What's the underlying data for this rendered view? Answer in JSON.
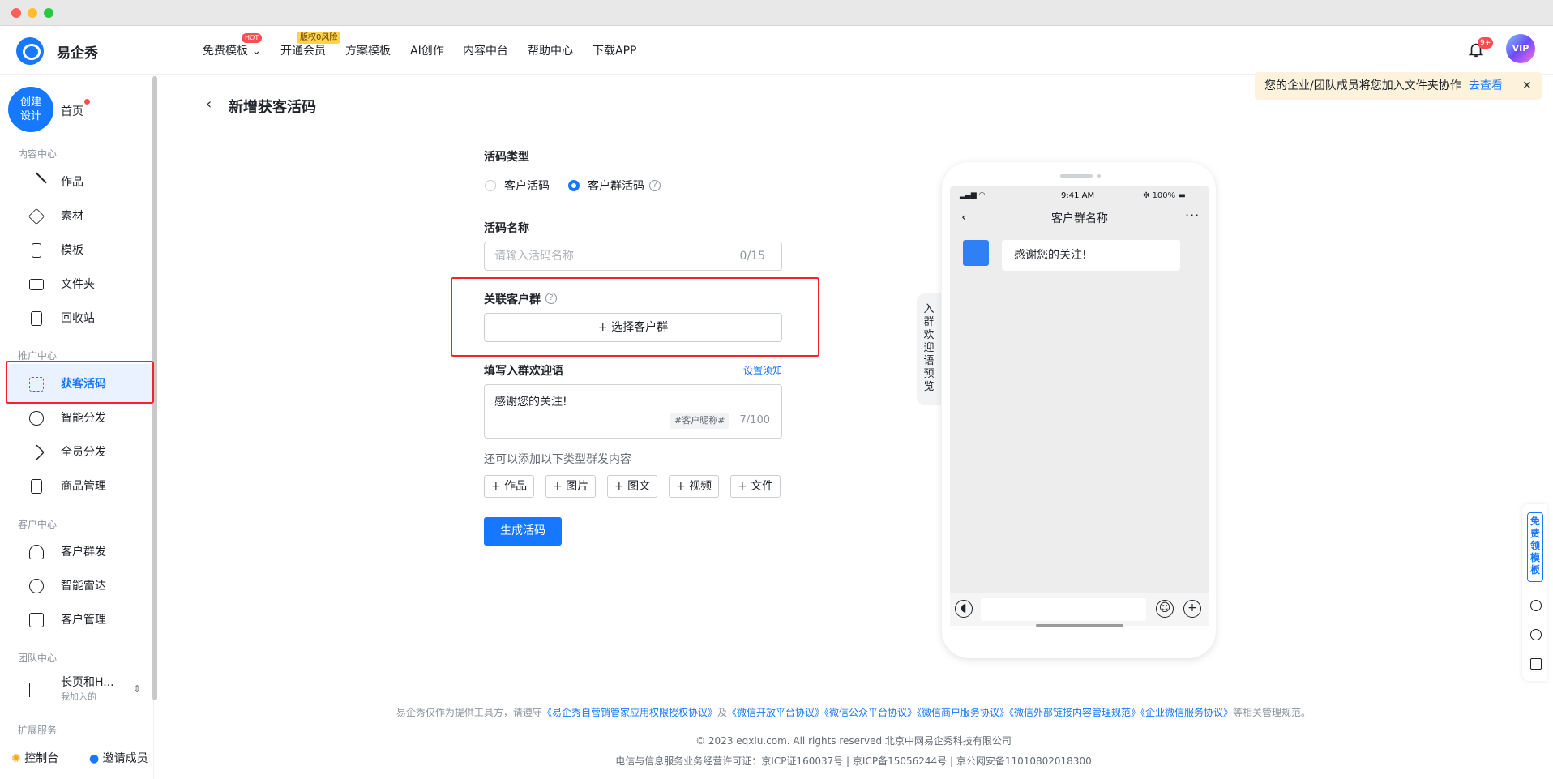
{
  "app": {
    "brand": "易企秀"
  },
  "nav": {
    "items": [
      "免费模板",
      "开通会员",
      "方案模板",
      "AI创作",
      "内容中台",
      "帮助中心",
      "下载APP"
    ],
    "hot_badge": "HOT",
    "vip_badge": "版权0风险",
    "bell_count": "9+",
    "avatar_label": "VIP"
  },
  "toast": {
    "text": "您的企业/团队成员将您加入文件夹协作",
    "link": "去查看",
    "close": "✕"
  },
  "sidebar": {
    "create": "创建设计",
    "create_l1": "创建",
    "create_l2": "设计",
    "home": "首页",
    "sections": {
      "content": "内容中心",
      "promo": "推广中心",
      "customer": "客户中心",
      "team": "团队中心",
      "ext": "扩展服务"
    },
    "content_items": [
      "作品",
      "素材",
      "模板",
      "文件夹",
      "回收站"
    ],
    "promo_items": [
      "获客活码",
      "智能分发",
      "全员分发",
      "商品管理"
    ],
    "customer_items": [
      "客户群发",
      "智能雷达",
      "客户管理"
    ],
    "team": {
      "name": "长页和H...",
      "sub": "我加入的"
    },
    "bottom": {
      "console": "控制台",
      "invite": "邀请成员"
    }
  },
  "page": {
    "back": "‹",
    "title": "新增获客活码",
    "type_label": "活码类型",
    "type_options": [
      "客户活码",
      "客户群活码"
    ],
    "selected_type": "客户群活码",
    "name_label": "活码名称",
    "name_placeholder": "请输入活码名称",
    "name_counter": "0/15",
    "group_label": "关联客户群",
    "select_group": "+ 选择客户群",
    "welcome_label": "填写入群欢迎语",
    "welcome_setting": "设置须知",
    "welcome_text": "感谢您的关注!",
    "nickname_tag": "#客户昵称#",
    "welcome_counter": "7/100",
    "extra_hint": "还可以添加以下类型群发内容",
    "add_buttons": [
      "+ 作品",
      "+ 图片",
      "+ 图文",
      "+ 视频",
      "+ 文件"
    ],
    "submit": "生成活码"
  },
  "preview": {
    "tab": "入群欢迎语预览",
    "time": "9:41 AM",
    "battery": "100%",
    "chat_title": "客户群名称",
    "message": "感谢您的关注!"
  },
  "right_float": {
    "free_template": "免费领模板"
  },
  "footer": {
    "prefix": "易企秀仅作为提供工具方，请遵守",
    "links": [
      "《易企秀自营销管家应用权限授权协议》",
      "《微信开放平台协议》",
      "《微信公众平台协议》",
      "《微信商户服务协议》",
      "《微信外部链接内容管理规范》",
      "《企业微信服务协议》"
    ],
    "and": "及",
    "suffix": "等相关管理规范。",
    "copyright": "© 2023 eqxiu.com. All rights reserved 北京中网易企秀科技有限公司",
    "license": "电信与信息服务业务经营许可证：京ICP证160037号 | 京ICP备15056244号 | 京公网安备11010802018300"
  },
  "colors": {
    "accent": "#1677ff",
    "highlight": "#f5222d",
    "toast_bg": "#fdf3dc"
  }
}
